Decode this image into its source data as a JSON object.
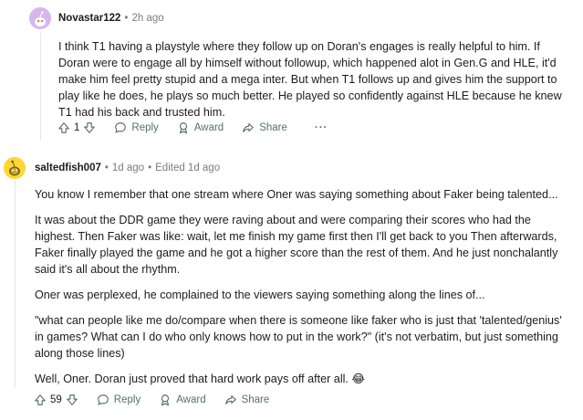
{
  "comments": [
    {
      "author": "Novastar122",
      "time": "2h ago",
      "edited": "",
      "paragraphs": [
        "I think T1 having a playstyle where they follow up on Doran's engages is really helpful to him. If Doran were to engage all by himself without followup, which happened alot in Gen.G and HLE, it'd make him feel pretty stupid and a mega inter. But when T1 follows up and gives him the support to play like he does, he plays so much better. He played so confidently against HLE because he knew T1 had his back and trusted him."
      ],
      "score": "1",
      "reply_label": "Reply",
      "award_label": "Award",
      "share_label": "Share",
      "more_label": "···"
    },
    {
      "author": "saltedfish007",
      "time": "1d ago",
      "edited": "Edited 1d ago",
      "paragraphs": [
        "You know I remember that one stream where Oner was saying something about Faker being talented...",
        "It was about the DDR game they were raving about and were comparing their scores who had the highest. Then Faker was like: wait, let me finish my game first then I'll get back to you Then afterwards, Faker finally played the game and he got a higher score than the rest of them. And he just nonchalantly said it's all about the rhythm.",
        "Oner was perplexed, he complained to the viewers saying something along the lines of...",
        "\"what can people like me do/compare when there is someone like faker who is just that 'talented/genius' in games? What can I do who only knows how to put in the work?\" (it's not verbatim, but just something along those lines)",
        "Well, Oner. Doran just proved that hard work pays off after all. 😂"
      ],
      "score": "59",
      "reply_label": "Reply",
      "award_label": "Award",
      "share_label": "Share"
    }
  ],
  "icons": {
    "upvote": "upvote-arrow-icon",
    "downvote": "downvote-arrow-icon",
    "reply": "speech-bubble-icon",
    "award": "award-ribbon-icon",
    "share": "share-arrow-icon"
  },
  "colors": {
    "avatar1_bg": "#d7b6ee",
    "avatar2_bg": "#ffd635",
    "meta_text": "#7c7c7c",
    "action_text": "#576f76"
  }
}
